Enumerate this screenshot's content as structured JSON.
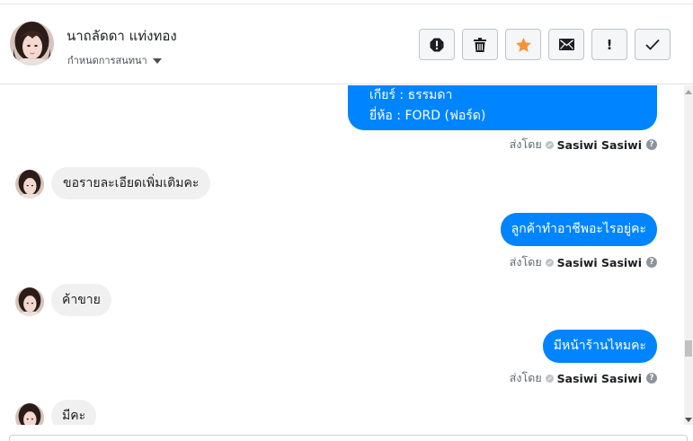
{
  "header": {
    "contact_name": "นาถลัดดา แท่งทอง",
    "conversation_label": "กำหนดการสนทนา",
    "actions": {
      "spam": "spam-icon",
      "delete": "trash-icon",
      "star": "star-icon",
      "mark_unread": "mail-icon",
      "follow_up": "!",
      "done": "check-icon"
    },
    "star_color": "#f7923b"
  },
  "messages": [
    {
      "direction": "out",
      "lines": [
        "เกียร์ : ธรรมดา",
        "ยี่ห้อ : FORD (ฟอร์ด)"
      ]
    },
    {
      "direction": "in",
      "text": "ขอรายละเอียดเพิ่มเติมคะ"
    },
    {
      "direction": "out",
      "text": "ลูกค้าทำอาชีพอะไรอยู่คะ"
    },
    {
      "direction": "in",
      "text": "ค้าขาย"
    },
    {
      "direction": "out",
      "text": "มีหน้าร้านไหมคะ"
    },
    {
      "direction": "in",
      "text": "มีคะ"
    }
  ],
  "sent_by": {
    "prefix": "ส่งโดย",
    "agent": "Sasiwi Sasiwi"
  },
  "colors": {
    "outgoing_bubble": "#0084ff",
    "incoming_bubble": "#f1f0f0"
  }
}
